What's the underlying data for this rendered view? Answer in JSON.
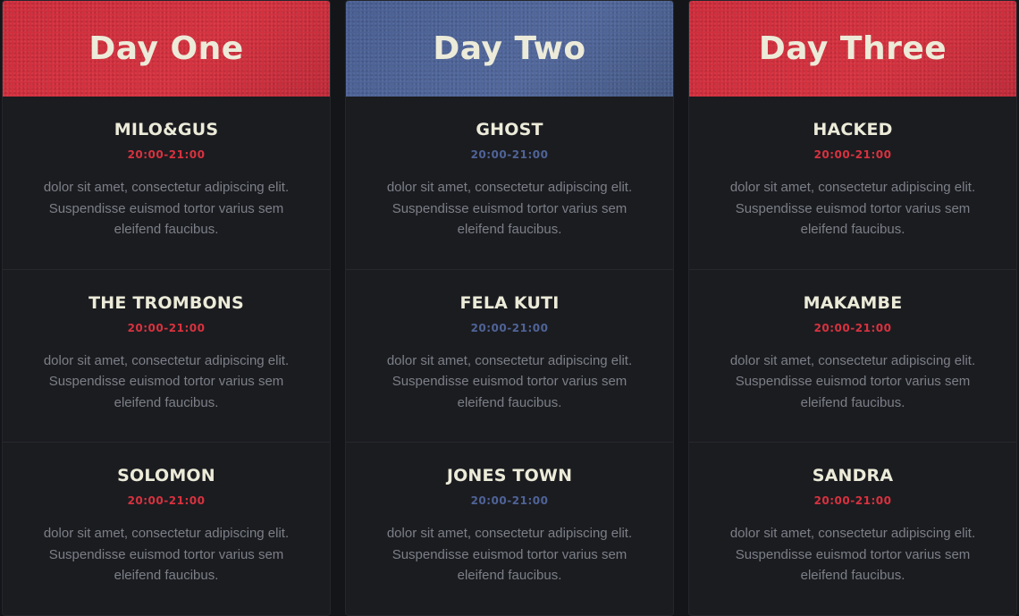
{
  "days": [
    {
      "title": "Day One",
      "acts": [
        {
          "name": "MILO&GUS",
          "time": "20:00-21:00",
          "desc": "dolor sit amet, consectetur adipiscing elit. Suspendisse euismod tortor varius sem eleifend faucibus."
        },
        {
          "name": "THE TROMBONS",
          "time": "20:00-21:00",
          "desc": "dolor sit amet, consectetur adipiscing elit. Suspendisse euismod tortor varius sem eleifend faucibus."
        },
        {
          "name": "SOLOMON",
          "time": "20:00-21:00",
          "desc": "dolor sit amet, consectetur adipiscing elit. Suspendisse euismod tortor varius sem eleifend faucibus."
        }
      ]
    },
    {
      "title": "Day Two",
      "acts": [
        {
          "name": "GHOST",
          "time": "20:00-21:00",
          "desc": "dolor sit amet, consectetur adipiscing elit. Suspendisse euismod tortor varius sem eleifend faucibus."
        },
        {
          "name": "FELA KUTI",
          "time": "20:00-21:00",
          "desc": "dolor sit amet, consectetur adipiscing elit. Suspendisse euismod tortor varius sem eleifend faucibus."
        },
        {
          "name": "JONES TOWN",
          "time": "20:00-21:00",
          "desc": "dolor sit amet, consectetur adipiscing elit. Suspendisse euismod tortor varius sem eleifend faucibus."
        }
      ]
    },
    {
      "title": "Day Three",
      "acts": [
        {
          "name": "HACKED",
          "time": "20:00-21:00",
          "desc": "dolor sit amet, consectetur adipiscing elit. Suspendisse euismod tortor varius sem eleifend faucibus."
        },
        {
          "name": "MAKAMBE",
          "time": "20:00-21:00",
          "desc": "dolor sit amet, consectetur adipiscing elit. Suspendisse euismod tortor varius sem eleifend faucibus."
        },
        {
          "name": "SANDRA",
          "time": "20:00-21:00",
          "desc": "dolor sit amet, consectetur adipiscing elit. Suspendisse euismod tortor varius sem eleifend faucibus."
        }
      ]
    }
  ],
  "colors": {
    "red": "#d6323f",
    "blue": "#52689c",
    "background": "#141518",
    "card": "#1b1c20",
    "heading_text": "#ecebd9",
    "body_text": "#7c7f88"
  }
}
